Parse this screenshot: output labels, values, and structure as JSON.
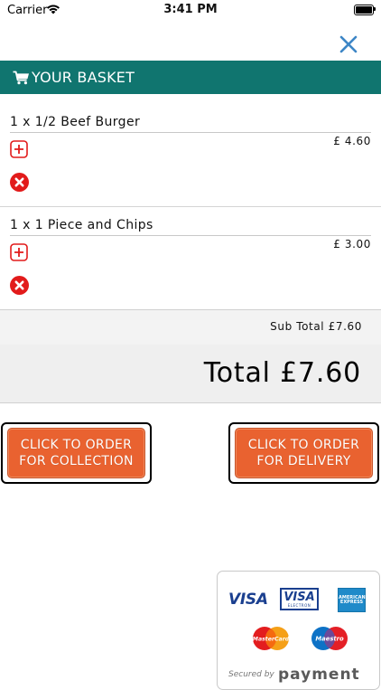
{
  "status": {
    "carrier": "Carrier",
    "time": "3:41 PM"
  },
  "header": {
    "title": "YOUR BASKET",
    "cart_icon": "cart-icon"
  },
  "items": [
    {
      "name": "1 x 1/2 Beef Burger",
      "price": "£ 4.60"
    },
    {
      "name": "1 x 1 Piece and Chips",
      "price": "£ 3.00"
    }
  ],
  "subtotal": "Sub Total £7.60",
  "total": "Total £7.60",
  "buttons": {
    "collection": "CLICK TO ORDER\nFOR COLLECTION",
    "delivery": "CLICK TO ORDER\nFOR DELIVERY"
  },
  "payment": {
    "visa": "VISA",
    "visa_electron": "VISA",
    "electron": "ELECTRON",
    "amex": "AMERICAN EXPRESS",
    "mastercard": "MasterCard",
    "maestro": "Maestro",
    "secured_by": "Secured by",
    "provider": "payment"
  },
  "colors": {
    "header_bg": "#10756f",
    "button_orange": "#e96230",
    "plus_red": "#e21b1b",
    "close_blue": "#3d86c6"
  }
}
